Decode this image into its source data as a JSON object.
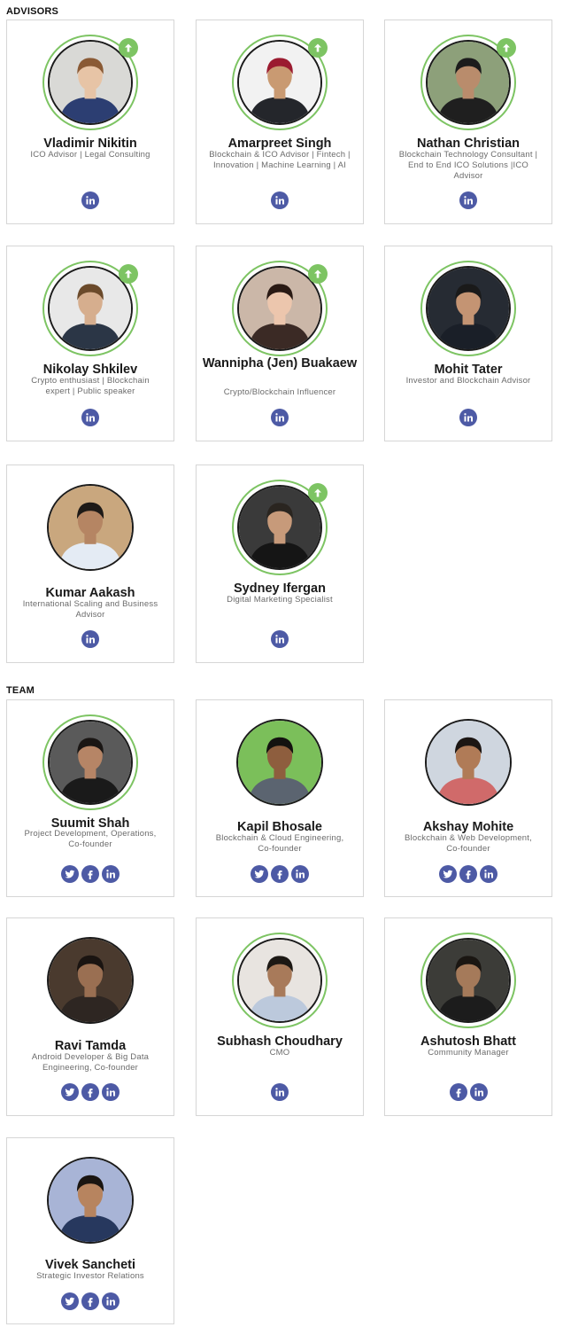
{
  "advisors": {
    "title": "ADVISORS",
    "members": [
      {
        "name": "Vladimir Nikitin",
        "role": "ICO Advisor | Legal Consulting",
        "ring": true,
        "badge": true,
        "socials": [
          "linkedin"
        ],
        "photo": {
          "bg": "#d9d9d6",
          "skin": "#e7c4a6",
          "hair": "#8a5a35",
          "shirt": "#2c3e72"
        }
      },
      {
        "name": "Amarpreet Singh",
        "role": "Blockchain & ICO Advisor | Fintech | Innovation | Machine Learning | AI",
        "ring": true,
        "badge": true,
        "socials": [
          "linkedin"
        ],
        "photo": {
          "bg": "#f2f2f2",
          "skin": "#c99a72",
          "hair": "#9b1b30",
          "shirt": "#24262b"
        }
      },
      {
        "name": "Nathan Christian",
        "role": "Blockchain Technology Consultant | End to End ICO Solutions |ICO Advisor",
        "ring": true,
        "badge": true,
        "socials": [
          "linkedin"
        ],
        "photo": {
          "bg": "#8da07a",
          "skin": "#b98c6c",
          "hair": "#1c1c1c",
          "shirt": "#1f1f1f"
        }
      },
      {
        "name": "Nikolay Shkilev",
        "role": "Crypto enthusiast | Blockchain expert | Public speaker",
        "ring": true,
        "badge": true,
        "socials": [
          "linkedin"
        ],
        "photo": {
          "bg": "#e8e8e8",
          "skin": "#d6ae8e",
          "hair": "#6b4a2b",
          "shirt": "#2b3646"
        }
      },
      {
        "name": "Wannipha (Jen) Buakaew",
        "role": "Crypto/Blockchain Influencer",
        "ring": true,
        "badge": true,
        "socials": [
          "linkedin"
        ],
        "photo": {
          "bg": "#cbb7a8",
          "skin": "#ecc6ad",
          "hair": "#2a1a14",
          "shirt": "#3b2a25"
        }
      },
      {
        "name": "Mohit Tater",
        "role": "Investor and Blockchain Advisor",
        "ring": true,
        "badge": false,
        "socials": [
          "linkedin"
        ],
        "photo": {
          "bg": "#262b33",
          "skin": "#c49473",
          "hair": "#1a1a1a",
          "shirt": "#1a1f28"
        }
      },
      {
        "name": "Kumar Aakash",
        "role": "International Scaling and Business Advisor",
        "ring": false,
        "badge": false,
        "socials": [
          "linkedin"
        ],
        "photo": {
          "bg": "#c9a77e",
          "skin": "#b58563",
          "hair": "#1e1a17",
          "shirt": "#e4ebf4"
        }
      },
      {
        "name": "Sydney Ifergan",
        "role": "Digital Marketing Specialist",
        "ring": true,
        "badge": true,
        "socials": [
          "linkedin"
        ],
        "photo": {
          "bg": "#3a3a3a",
          "skin": "#c79a7a",
          "hair": "#2a2520",
          "shirt": "#151515"
        }
      }
    ]
  },
  "team": {
    "title": "TEAM",
    "members": [
      {
        "name": "Suumit Shah",
        "role": "Project Development, Operations, Co-founder",
        "ring": true,
        "badge": false,
        "socials": [
          "twitter",
          "facebook",
          "linkedin"
        ],
        "photo": {
          "bg": "#5a5a5a",
          "skin": "#b68566",
          "hair": "#1a1614",
          "shirt": "#1a1a1a"
        }
      },
      {
        "name": "Kapil Bhosale",
        "role": "Blockchain & Cloud Engineering, Co-founder",
        "ring": false,
        "badge": false,
        "socials": [
          "twitter",
          "facebook",
          "linkedin"
        ],
        "photo": {
          "bg": "#7bbf5a",
          "skin": "#8e5e3e",
          "hair": "#141210",
          "shirt": "#5b6470"
        }
      },
      {
        "name": "Akshay Mohite",
        "role": "Blockchain & Web Development, Co-founder",
        "ring": false,
        "badge": false,
        "socials": [
          "twitter",
          "facebook",
          "linkedin"
        ],
        "photo": {
          "bg": "#cfd6df",
          "skin": "#b07b57",
          "hair": "#1c1613",
          "shirt": "#d06a6a"
        }
      },
      {
        "name": "Ravi Tamda",
        "role": "Android Developer & Big Data Engineering, Co-founder",
        "ring": false,
        "badge": false,
        "socials": [
          "twitter",
          "facebook",
          "linkedin"
        ],
        "photo": {
          "bg": "#4a3a2e",
          "skin": "#9a6f52",
          "hair": "#1a1411",
          "shirt": "#2e2622"
        }
      },
      {
        "name": "Subhash Choudhary",
        "role": "CMO",
        "ring": true,
        "badge": false,
        "socials": [
          "linkedin"
        ],
        "photo": {
          "bg": "#e8e4e0",
          "skin": "#a87a5a",
          "hair": "#1c1814",
          "shirt": "#bcc9dc"
        }
      },
      {
        "name": "Ashutosh Bhatt",
        "role": "Community Manager",
        "ring": true,
        "badge": false,
        "socials": [
          "facebook",
          "linkedin"
        ],
        "photo": {
          "bg": "#3c3c38",
          "skin": "#a57a5a",
          "hair": "#1a1612",
          "shirt": "#1c1c1c"
        }
      },
      {
        "name": "Vivek Sancheti",
        "role": "Strategic Investor Relations",
        "ring": false,
        "badge": false,
        "socials": [
          "twitter",
          "facebook",
          "linkedin"
        ],
        "photo": {
          "bg": "#a8b4d6",
          "skin": "#b7845f",
          "hair": "#1a1511",
          "shirt": "#27385e"
        }
      }
    ]
  }
}
